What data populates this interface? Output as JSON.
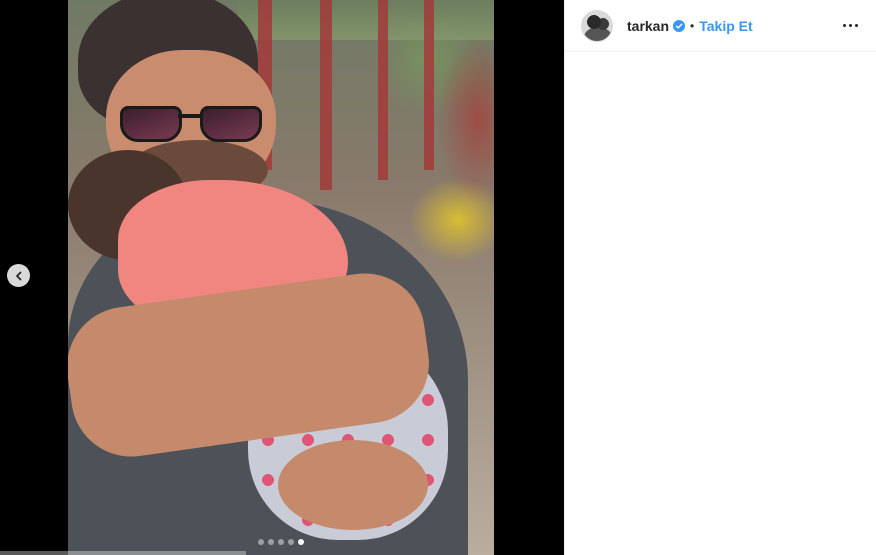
{
  "post": {
    "author": {
      "username": "tarkan",
      "verified": true
    },
    "separator": "•",
    "follow_label": "Takip Et",
    "carousel": {
      "slide_count": 5,
      "active_index": 4
    }
  },
  "icons": {
    "prev": "chevron-left-icon",
    "verified": "verified-badge-icon",
    "more": "more-options-icon"
  },
  "colors": {
    "link": "#3897f0",
    "verified": "#3897f0",
    "text": "#262626",
    "media_bg": "#000000"
  }
}
